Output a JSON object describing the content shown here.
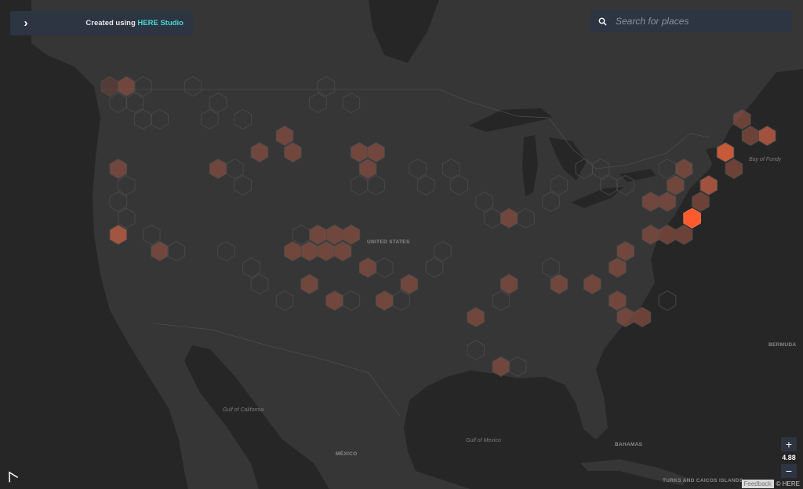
{
  "panel": {
    "credit_prefix": "Created using",
    "credit_brand": "HERE Studio"
  },
  "search": {
    "placeholder": "Search for places"
  },
  "zoom": {
    "plus": "+",
    "level": "4.88",
    "minus": "−"
  },
  "footer": {
    "feedback": "Feedback",
    "copyright": "© HERE"
  },
  "labels": {
    "united_states": "UNITED STATES",
    "mexico": "MÉXICO",
    "gulf_of_california": "Gulf of California",
    "gulf_of_mexico": "Gulf of Mexico",
    "bahamas": "BAHAMAS",
    "bermuda": "BERMUDA",
    "bay_of_fundy": "Bay of Fundy",
    "turks_caicos": "TURKS AND CAICOS ISLANDS"
  },
  "colors": {
    "land": "#363636",
    "water": "#262626",
    "hex_outline": "#4a4a4a",
    "hex_low": "#7a4a3e",
    "hex_mid": "#a85a44",
    "hex_high": "#ff5a2d",
    "accent": "#48dad0"
  },
  "icons": {
    "expand": "chevron-right-icon",
    "search": "search-icon",
    "logo": "here-logo"
  },
  "hex_density": [
    {
      "col": 0,
      "row": 0,
      "v": 1
    },
    {
      "col": 1,
      "row": 0,
      "v": 2
    },
    {
      "col": 2,
      "row": 0,
      "v": 0
    },
    {
      "col": 0,
      "row": 1,
      "v": 0
    },
    {
      "col": 1,
      "row": 1,
      "v": 0
    },
    {
      "col": 5,
      "row": 0,
      "v": 0
    },
    {
      "col": 6,
      "row": 1,
      "v": 0
    },
    {
      "col": 6,
      "row": 2,
      "v": 0
    },
    {
      "col": 2,
      "row": 2,
      "v": 0
    },
    {
      "col": 3,
      "row": 2,
      "v": 0
    },
    {
      "col": 0,
      "row": 5,
      "v": 2
    },
    {
      "col": 1,
      "row": 6,
      "v": 0
    },
    {
      "col": 0,
      "row": 7,
      "v": 0
    },
    {
      "col": 1,
      "row": 8,
      "v": 0
    },
    {
      "col": 0,
      "row": 9,
      "v": 3
    },
    {
      "col": 2,
      "row": 9,
      "v": 0
    },
    {
      "col": 3,
      "row": 10,
      "v": 2
    },
    {
      "col": 4,
      "row": 10,
      "v": 0
    },
    {
      "col": 6,
      "row": 5,
      "v": 2
    },
    {
      "col": 7,
      "row": 5,
      "v": 0
    },
    {
      "col": 8,
      "row": 6,
      "v": 0
    },
    {
      "col": 9,
      "row": 4,
      "v": 2
    },
    {
      "col": 8,
      "row": 2,
      "v": 0
    },
    {
      "col": 10,
      "row": 3,
      "v": 2
    },
    {
      "col": 12,
      "row": 1,
      "v": 0
    },
    {
      "col": 11,
      "row": 4,
      "v": 2
    },
    {
      "col": 13,
      "row": 0,
      "v": 0
    },
    {
      "col": 14,
      "row": 1,
      "v": 0
    },
    {
      "col": 15,
      "row": 4,
      "v": 2
    },
    {
      "col": 15,
      "row": 5,
      "v": 2
    },
    {
      "col": 16,
      "row": 4,
      "v": 2
    },
    {
      "col": 15,
      "row": 6,
      "v": 0
    },
    {
      "col": 16,
      "row": 6,
      "v": 0
    },
    {
      "col": 18,
      "row": 5,
      "v": 0
    },
    {
      "col": 19,
      "row": 6,
      "v": 0
    },
    {
      "col": 20,
      "row": 5,
      "v": 0
    },
    {
      "col": 21,
      "row": 6,
      "v": 0
    },
    {
      "col": 22,
      "row": 7,
      "v": 0
    },
    {
      "col": 23,
      "row": 8,
      "v": 0
    },
    {
      "col": 24,
      "row": 8,
      "v": 2
    },
    {
      "col": 25,
      "row": 8,
      "v": 0
    },
    {
      "col": 26,
      "row": 7,
      "v": 0
    },
    {
      "col": 27,
      "row": 6,
      "v": 0
    },
    {
      "col": 28,
      "row": 5,
      "v": 0
    },
    {
      "col": 29,
      "row": 5,
      "v": 0
    },
    {
      "col": 30,
      "row": 6,
      "v": 0
    },
    {
      "col": 31,
      "row": 6,
      "v": 0
    },
    {
      "col": 32,
      "row": 7,
      "v": 2
    },
    {
      "col": 33,
      "row": 7,
      "v": 2
    },
    {
      "col": 34,
      "row": 6,
      "v": 2
    },
    {
      "col": 35,
      "row": 7,
      "v": 2
    },
    {
      "col": 35,
      "row": 8,
      "v": 5
    },
    {
      "col": 36,
      "row": 6,
      "v": 3
    },
    {
      "col": 37,
      "row": 5,
      "v": 2
    },
    {
      "col": 37,
      "row": 4,
      "v": 4
    },
    {
      "col": 38,
      "row": 3,
      "v": 2
    },
    {
      "col": 38,
      "row": 2,
      "v": 2
    },
    {
      "col": 39,
      "row": 3,
      "v": 3
    },
    {
      "col": 34,
      "row": 5,
      "v": 2
    },
    {
      "col": 33,
      "row": 5,
      "v": 0
    },
    {
      "col": 32,
      "row": 9,
      "v": 2
    },
    {
      "col": 33,
      "row": 9,
      "v": 2
    },
    {
      "col": 34,
      "row": 9,
      "v": 2
    },
    {
      "col": 31,
      "row": 10,
      "v": 2
    },
    {
      "col": 30,
      "row": 11,
      "v": 2
    },
    {
      "col": 29,
      "row": 12,
      "v": 2
    },
    {
      "col": 30,
      "row": 13,
      "v": 2
    },
    {
      "col": 31,
      "row": 14,
      "v": 2
    },
    {
      "col": 32,
      "row": 14,
      "v": 2
    },
    {
      "col": 33,
      "row": 13,
      "v": 0
    },
    {
      "col": 27,
      "row": 12,
      "v": 2
    },
    {
      "col": 26,
      "row": 11,
      "v": 0
    },
    {
      "col": 24,
      "row": 12,
      "v": 2
    },
    {
      "col": 23,
      "row": 13,
      "v": 0
    },
    {
      "col": 22,
      "row": 14,
      "v": 2
    },
    {
      "col": 20,
      "row": 10,
      "v": 0
    },
    {
      "col": 19,
      "row": 11,
      "v": 0
    },
    {
      "col": 18,
      "row": 12,
      "v": 2
    },
    {
      "col": 17,
      "row": 13,
      "v": 0
    },
    {
      "col": 13,
      "row": 9,
      "v": 2
    },
    {
      "col": 13,
      "row": 10,
      "v": 2
    },
    {
      "col": 14,
      "row": 9,
      "v": 2
    },
    {
      "col": 14,
      "row": 10,
      "v": 2
    },
    {
      "col": 12,
      "row": 10,
      "v": 2
    },
    {
      "col": 12,
      "row": 9,
      "v": 2
    },
    {
      "col": 11,
      "row": 9,
      "v": 0
    },
    {
      "col": 11,
      "row": 10,
      "v": 2
    },
    {
      "col": 15,
      "row": 11,
      "v": 2
    },
    {
      "col": 16,
      "row": 11,
      "v": 0
    },
    {
      "col": 12,
      "row": 12,
      "v": 2
    },
    {
      "col": 13,
      "row": 13,
      "v": 2
    },
    {
      "col": 14,
      "row": 13,
      "v": 0
    },
    {
      "col": 16,
      "row": 13,
      "v": 2
    },
    {
      "col": 10,
      "row": 13,
      "v": 0
    },
    {
      "col": 9,
      "row": 12,
      "v": 0
    },
    {
      "col": 8,
      "row": 11,
      "v": 0
    },
    {
      "col": 7,
      "row": 10,
      "v": 0
    },
    {
      "col": 22,
      "row": 16,
      "v": 0
    },
    {
      "col": 23,
      "row": 17,
      "v": 2
    },
    {
      "col": 24,
      "row": 17,
      "v": 0
    }
  ]
}
